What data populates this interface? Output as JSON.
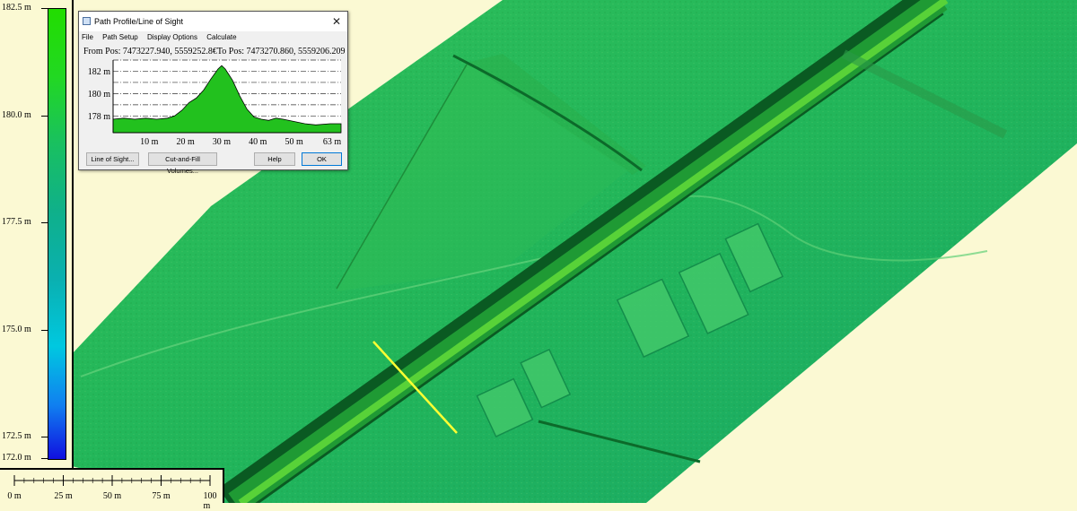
{
  "dialog": {
    "title": "Path Profile/Line of Sight",
    "menu": [
      "File",
      "Path Setup",
      "Display Options",
      "Calculate"
    ],
    "position_text": "From Pos: 7473227.940, 5559252.8€To Pos: 7473270.860, 5559206.209",
    "buttons": {
      "line_of_sight": "Line of Sight...",
      "cut_fill": "Cut-and-Fill Volumes...",
      "help": "Help",
      "ok": "OK"
    }
  },
  "chart_data": {
    "type": "area",
    "y_ticks": [
      "182 m",
      "180 m",
      "178 m"
    ],
    "x_ticks": [
      "10 m",
      "20 m",
      "30 m",
      "40 m",
      "50 m",
      "63 m"
    ],
    "x_tick_values": [
      10,
      20,
      30,
      40,
      50,
      63
    ],
    "y_tick_values": [
      182,
      180,
      178
    ],
    "xlim": [
      0,
      63
    ],
    "ylim": [
      176.5,
      183
    ],
    "grid": true,
    "fill_color": "#22c11e",
    "x": [
      0,
      3,
      6,
      9,
      12,
      15,
      17,
      19,
      21,
      23,
      25,
      27,
      29,
      30,
      31,
      33,
      35,
      37,
      39,
      41,
      43,
      45,
      47,
      50,
      53,
      56,
      60,
      63
    ],
    "values": [
      177.7,
      177.8,
      177.7,
      177.8,
      177.7,
      177.8,
      178.0,
      178.5,
      179.2,
      179.6,
      180.3,
      181.3,
      182.2,
      182.5,
      182.2,
      181.2,
      179.8,
      178.6,
      177.9,
      177.7,
      177.6,
      177.8,
      177.7,
      177.5,
      177.3,
      177.2,
      177.3,
      177.3
    ]
  },
  "legend": {
    "labels": [
      "182.5 m",
      "180.0 m",
      "177.5 m",
      "175.0 m",
      "172.5 m",
      "172.0 m"
    ],
    "values": [
      182.5,
      180.0,
      177.5,
      175.0,
      172.5,
      172.0
    ],
    "range": [
      172.0,
      182.5
    ]
  },
  "scale_bar": {
    "labels": [
      "0 m",
      "25 m",
      "50 m",
      "75 m",
      "100 m"
    ],
    "values": [
      0,
      25,
      50,
      75,
      100
    ]
  },
  "profile_line_color": "#ffff33"
}
